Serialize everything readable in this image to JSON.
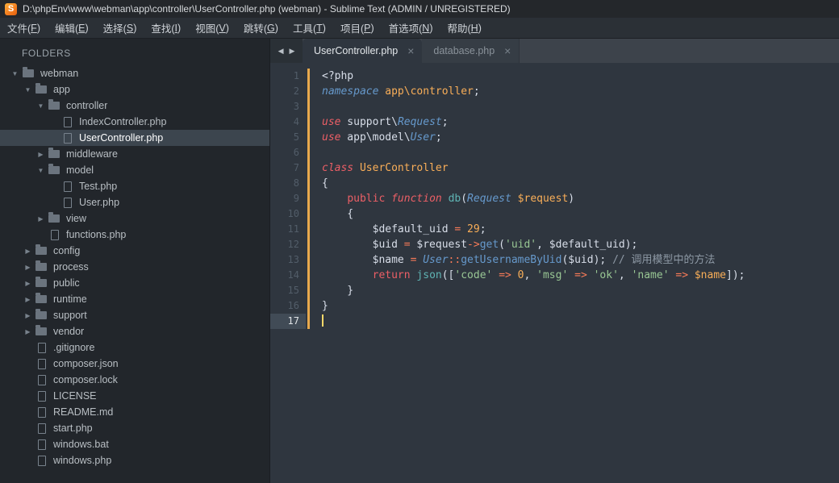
{
  "window": {
    "title": "D:\\phpEnv\\www\\webman\\app\\controller\\UserController.php (webman) - Sublime Text (ADMIN / UNREGISTERED)",
    "logo_letter": "S"
  },
  "menu": {
    "items": [
      {
        "label": "文件(F)",
        "name": "file"
      },
      {
        "label": "编辑(E)",
        "name": "edit"
      },
      {
        "label": "选择(S)",
        "name": "selection"
      },
      {
        "label": "查找(I)",
        "name": "find"
      },
      {
        "label": "视图(V)",
        "name": "view"
      },
      {
        "label": "跳转(G)",
        "name": "goto"
      },
      {
        "label": "工具(T)",
        "name": "tools"
      },
      {
        "label": "项目(P)",
        "name": "project"
      },
      {
        "label": "首选项(N)",
        "name": "preferences"
      },
      {
        "label": "帮助(H)",
        "name": "help"
      }
    ]
  },
  "sidebar": {
    "header": "FOLDERS",
    "expanded_glyph": "▼",
    "collapsed_glyph": "▶",
    "tree": [
      {
        "label": "webman",
        "depth": 0,
        "type": "folder-open"
      },
      {
        "label": "app",
        "depth": 1,
        "type": "folder-open"
      },
      {
        "label": "controller",
        "depth": 2,
        "type": "folder-open"
      },
      {
        "label": "IndexController.php",
        "depth": 3,
        "type": "file"
      },
      {
        "label": "UserController.php",
        "depth": 3,
        "type": "file",
        "selected": true
      },
      {
        "label": "middleware",
        "depth": 2,
        "type": "folder-closed"
      },
      {
        "label": "model",
        "depth": 2,
        "type": "folder-open"
      },
      {
        "label": "Test.php",
        "depth": 3,
        "type": "file"
      },
      {
        "label": "User.php",
        "depth": 3,
        "type": "file"
      },
      {
        "label": "view",
        "depth": 2,
        "type": "folder-closed"
      },
      {
        "label": "functions.php",
        "depth": 2,
        "type": "file"
      },
      {
        "label": "config",
        "depth": 1,
        "type": "folder-closed"
      },
      {
        "label": "process",
        "depth": 1,
        "type": "folder-closed"
      },
      {
        "label": "public",
        "depth": 1,
        "type": "folder-closed"
      },
      {
        "label": "runtime",
        "depth": 1,
        "type": "folder-closed"
      },
      {
        "label": "support",
        "depth": 1,
        "type": "folder-closed"
      },
      {
        "label": "vendor",
        "depth": 1,
        "type": "folder-closed"
      },
      {
        "label": ".gitignore",
        "depth": 1,
        "type": "file"
      },
      {
        "label": "composer.json",
        "depth": 1,
        "type": "file"
      },
      {
        "label": "composer.lock",
        "depth": 1,
        "type": "file"
      },
      {
        "label": "LICENSE",
        "depth": 1,
        "type": "file"
      },
      {
        "label": "README.md",
        "depth": 1,
        "type": "file"
      },
      {
        "label": "start.php",
        "depth": 1,
        "type": "file"
      },
      {
        "label": "windows.bat",
        "depth": 1,
        "type": "file"
      },
      {
        "label": "windows.php",
        "depth": 1,
        "type": "file"
      }
    ]
  },
  "tabbar": {
    "scroll_left_icon": "◀",
    "scroll_right_icon": "▶",
    "close_glyph": "×",
    "tabs": [
      {
        "label": "UserController.php",
        "active": true
      },
      {
        "label": "database.php",
        "active": false
      }
    ]
  },
  "editor": {
    "active_line": 17,
    "lines": [
      {
        "n": 1,
        "tokens": [
          [
            "pl",
            "<?php"
          ]
        ]
      },
      {
        "n": 2,
        "tokens": [
          [
            "kwb",
            "namespace"
          ],
          [
            "pl",
            " "
          ],
          [
            "or",
            "app\\controller"
          ],
          [
            "pl",
            ";"
          ]
        ]
      },
      {
        "n": 3,
        "tokens": []
      },
      {
        "n": 4,
        "tokens": [
          [
            "kwi",
            "use"
          ],
          [
            "pl",
            " support\\"
          ],
          [
            "kwb",
            "Request"
          ],
          [
            "pl",
            ";"
          ]
        ]
      },
      {
        "n": 5,
        "tokens": [
          [
            "kwi",
            "use"
          ],
          [
            "pl",
            " app\\model\\"
          ],
          [
            "kwb",
            "User"
          ],
          [
            "pl",
            ";"
          ]
        ]
      },
      {
        "n": 6,
        "tokens": []
      },
      {
        "n": 7,
        "tokens": [
          [
            "kwi",
            "class"
          ],
          [
            "pl",
            " "
          ],
          [
            "or",
            "UserController"
          ]
        ]
      },
      {
        "n": 8,
        "tokens": [
          [
            "pl",
            "{"
          ]
        ]
      },
      {
        "n": 9,
        "tokens": [
          [
            "pl",
            "    "
          ],
          [
            "kwu",
            "public"
          ],
          [
            "pl",
            " "
          ],
          [
            "kwi",
            "function"
          ],
          [
            "pl",
            " "
          ],
          [
            "fn",
            "db"
          ],
          [
            "pl",
            "("
          ],
          [
            "kwb",
            "Request"
          ],
          [
            "pl",
            " "
          ],
          [
            "or",
            "$request"
          ],
          [
            "pl",
            ")"
          ]
        ]
      },
      {
        "n": 10,
        "tokens": [
          [
            "pl",
            "    {"
          ]
        ]
      },
      {
        "n": 11,
        "tokens": [
          [
            "pl",
            "        $default_uid "
          ],
          [
            "op",
            "="
          ],
          [
            "pl",
            " "
          ],
          [
            "num",
            "29"
          ],
          [
            "pl",
            ";"
          ]
        ]
      },
      {
        "n": 12,
        "tokens": [
          [
            "pl",
            "        $uid "
          ],
          [
            "op",
            "="
          ],
          [
            "pl",
            " $request"
          ],
          [
            "op",
            "->"
          ],
          [
            "mth",
            "get"
          ],
          [
            "pl",
            "("
          ],
          [
            "str",
            "'uid'"
          ],
          [
            "pl",
            ", $default_uid);"
          ]
        ]
      },
      {
        "n": 13,
        "tokens": [
          [
            "pl",
            "        $name "
          ],
          [
            "op",
            "="
          ],
          [
            "pl",
            " "
          ],
          [
            "kwb",
            "User"
          ],
          [
            "op",
            "::"
          ],
          [
            "mth",
            "getUsernameByUid"
          ],
          [
            "pl",
            "($uid); "
          ],
          [
            "cmt",
            "// 调用模型中的方法"
          ]
        ]
      },
      {
        "n": 14,
        "tokens": [
          [
            "pl",
            "        "
          ],
          [
            "kwu",
            "return"
          ],
          [
            "pl",
            " "
          ],
          [
            "fn",
            "json"
          ],
          [
            "pl",
            "(["
          ],
          [
            "str",
            "'code'"
          ],
          [
            "pl",
            " "
          ],
          [
            "op",
            "=>"
          ],
          [
            "pl",
            " "
          ],
          [
            "num",
            "0"
          ],
          [
            "pl",
            ", "
          ],
          [
            "str",
            "'msg'"
          ],
          [
            "pl",
            " "
          ],
          [
            "op",
            "=>"
          ],
          [
            "pl",
            " "
          ],
          [
            "str",
            "'ok'"
          ],
          [
            "pl",
            ", "
          ],
          [
            "str",
            "'name'"
          ],
          [
            "pl",
            " "
          ],
          [
            "op",
            "=>"
          ],
          [
            "pl",
            " "
          ],
          [
            "or",
            "$name"
          ],
          [
            "pl",
            "]);"
          ]
        ]
      },
      {
        "n": 15,
        "tokens": [
          [
            "pl",
            "    }"
          ]
        ]
      },
      {
        "n": 16,
        "tokens": [
          [
            "pl",
            "}"
          ]
        ]
      },
      {
        "n": 17,
        "tokens": []
      }
    ]
  },
  "colors": {
    "modified_indicator": "#e7a94d",
    "selection_row": "#3c454e",
    "logo_orange": "#f47c1e",
    "editor_bg": "#2f363f",
    "sidebar_bg": "#22262b"
  }
}
